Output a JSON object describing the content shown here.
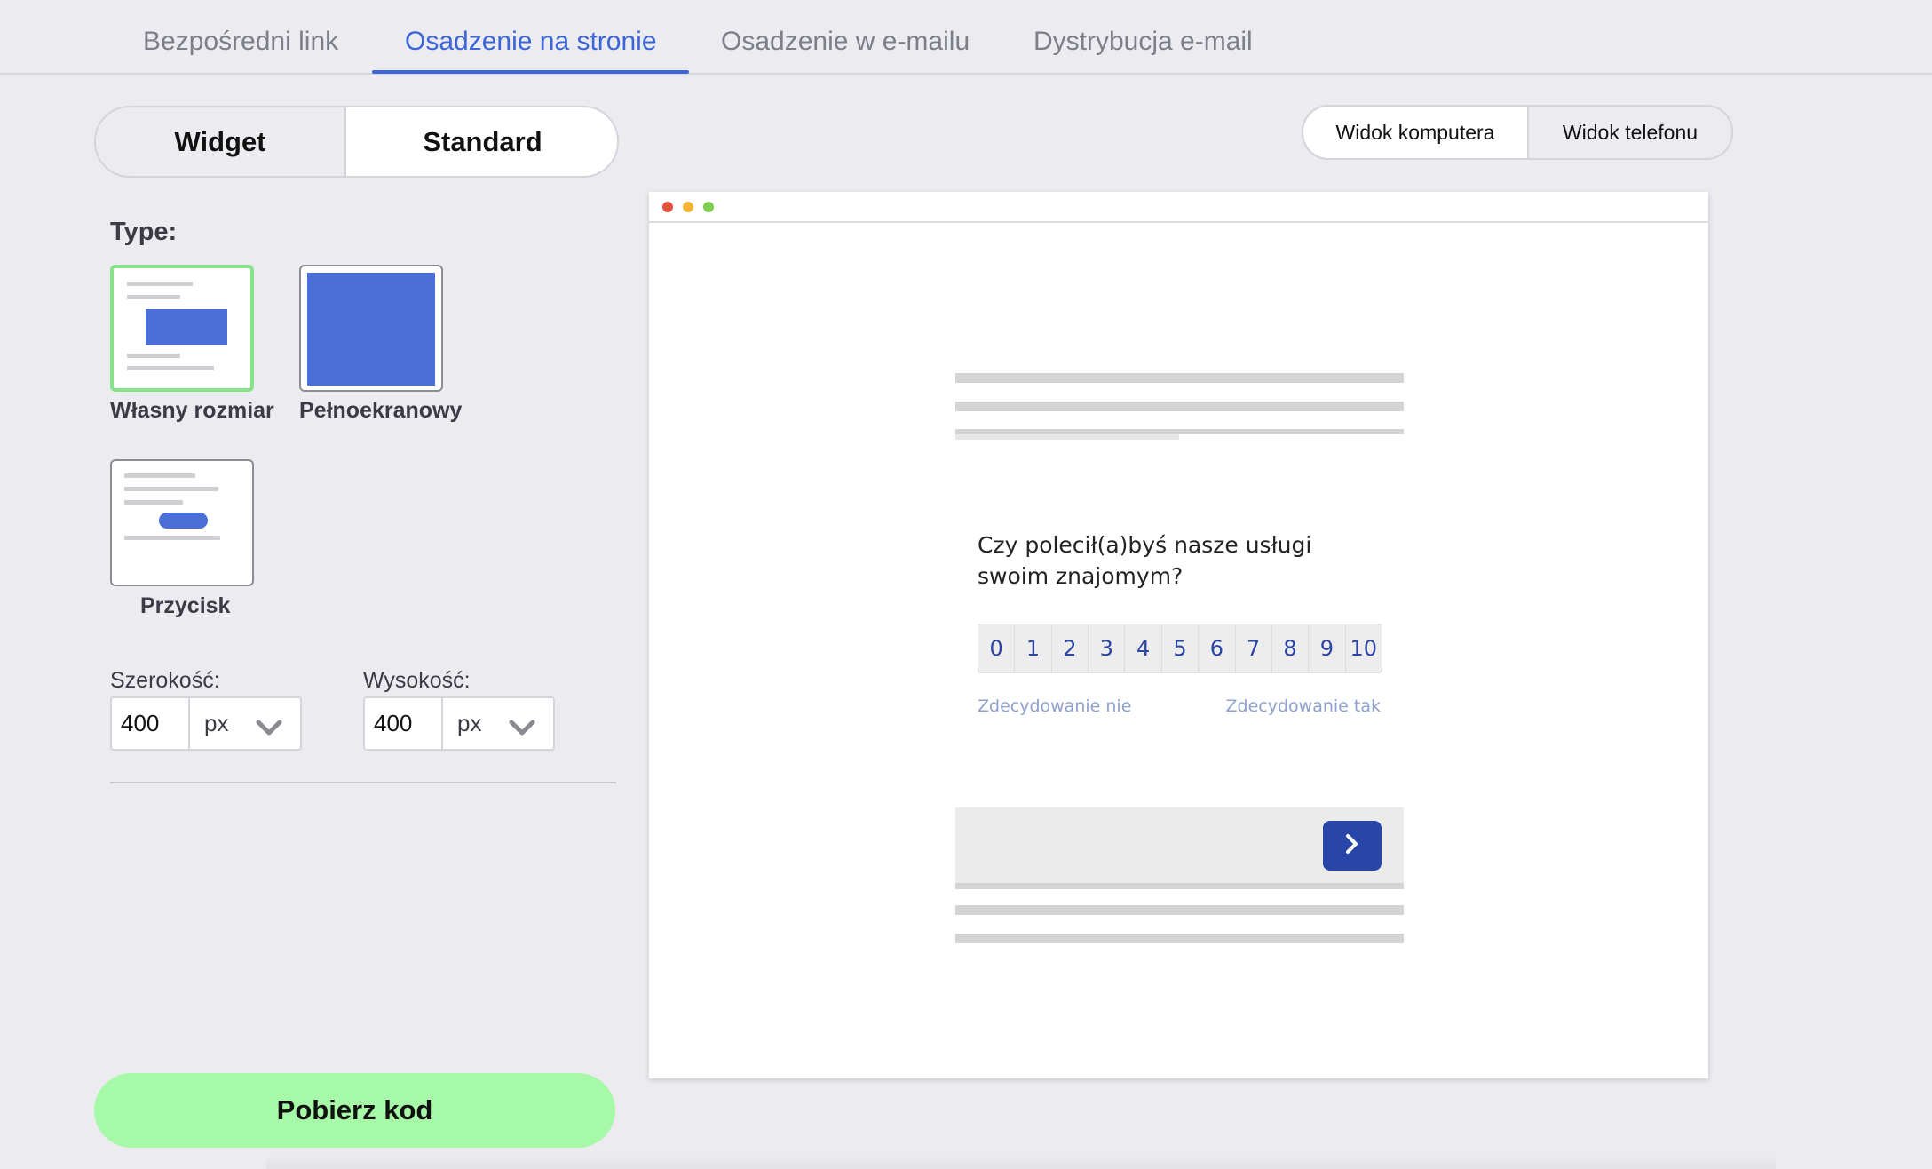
{
  "tabs": [
    {
      "label": "Bezpośredni link",
      "active": false
    },
    {
      "label": "Osadzenie na stronie",
      "active": true
    },
    {
      "label": "Osadzenie w e-mailu",
      "active": false
    },
    {
      "label": "Dystrybucja e-mail",
      "active": false
    }
  ],
  "mode_toggle": {
    "widget_label": "Widget",
    "standard_label": "Standard",
    "selected": "Standard"
  },
  "device_toggle": {
    "desktop_label": "Widok komputera",
    "mobile_label": "Widok telefonu",
    "selected": "Widok komputera"
  },
  "type_section": {
    "label": "Type:",
    "options": [
      {
        "label": "Własny rozmiar",
        "selected": true
      },
      {
        "label": "Pełnoekranowy",
        "selected": false
      },
      {
        "label": "Przycisk",
        "selected": false
      }
    ]
  },
  "size": {
    "width_label": "Szerokość:",
    "width_value": "400",
    "width_unit": "px",
    "height_label": "Wysokość:",
    "height_value": "400",
    "height_unit": "px"
  },
  "download_label": "Pobierz kod",
  "preview": {
    "question": "Czy polecił(a)byś nasze usługi swoim znajomym?",
    "scale": [
      "0",
      "1",
      "2",
      "3",
      "4",
      "5",
      "6",
      "7",
      "8",
      "9",
      "10"
    ],
    "scale_low_label": "Zdecydowanie nie",
    "scale_high_label": "Zdecydowanie tak"
  },
  "colors": {
    "accent": "#3c66d8",
    "selected_border": "#86e38c",
    "download_button": "#a6f9a7",
    "next_button": "#2746a8",
    "scale_text": "#2b45a6",
    "window_dot_red": "#e0533d",
    "window_dot_yellow": "#f4b433",
    "window_dot_green": "#7ccf4d"
  },
  "icons": {
    "next": "chevron-right-icon",
    "unit_dropdown": "chevron-down-icon"
  }
}
